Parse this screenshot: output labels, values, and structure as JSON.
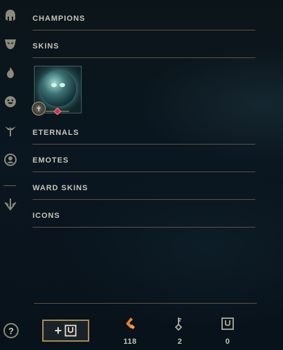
{
  "sidebar": {
    "items": [
      {
        "icon": "champion-helmet-icon"
      },
      {
        "icon": "skin-mask-icon"
      },
      {
        "icon": "eternals-flame-icon"
      },
      {
        "icon": "emote-face-icon"
      },
      {
        "icon": "ward-totem-icon"
      },
      {
        "icon": "icons-profile-icon"
      },
      {
        "icon": "loot-arrow-icon"
      }
    ]
  },
  "sections": {
    "champions": "CHAMPIONS",
    "skins": "SKINS",
    "eternals": "ETERNALS",
    "emotes": "EMOTES",
    "ward_skins": "WARD SKINS",
    "icons": "ICONS"
  },
  "footer": {
    "help_label": "?",
    "add_label": "+",
    "currencies": [
      {
        "name": "orange-essence",
        "value": "118",
        "color": "#e8822a"
      },
      {
        "name": "keys",
        "value": "2",
        "color": "#b0ad98"
      },
      {
        "name": "chests",
        "value": "0",
        "color": "#b0ad98"
      }
    ]
  },
  "colors": {
    "gold_line": "#5c5440",
    "text": "#c8c6b6",
    "button_border": "#a88d53",
    "essence": "#e8822a"
  }
}
